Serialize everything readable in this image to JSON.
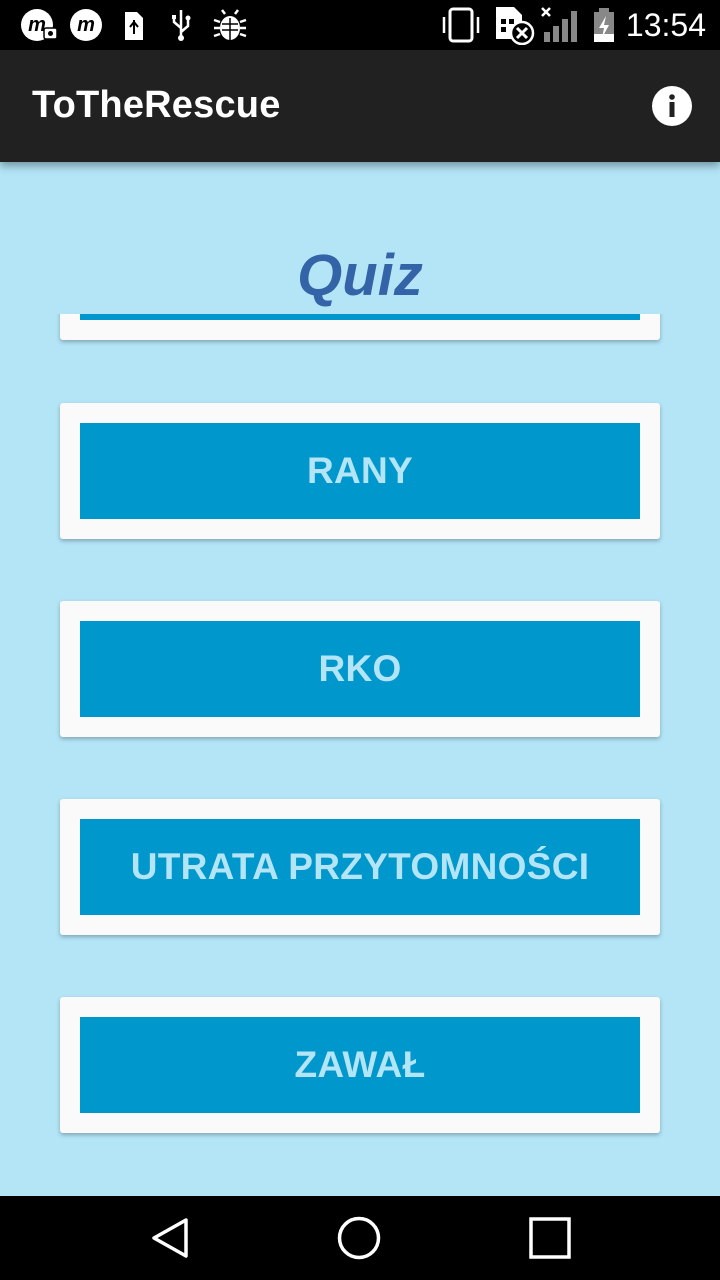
{
  "status_bar": {
    "time": "13:54",
    "icons": [
      "m-camera-icon",
      "m-icon",
      "sd-card-icon",
      "usb-icon",
      "bug-icon",
      "vibrate-icon",
      "sim-error-icon",
      "signal-icon",
      "battery-icon"
    ]
  },
  "app_bar": {
    "title": "ToTheRescue",
    "info_icon": "info-icon"
  },
  "main": {
    "title": "Quiz",
    "categories": [
      {
        "label": ""
      },
      {
        "label": "RANY"
      },
      {
        "label": "RKO"
      },
      {
        "label": "UTRATA PRZYTOMNOŚCI"
      },
      {
        "label": "ZAWAŁ"
      }
    ]
  },
  "nav_bar": {
    "icons": [
      "back-icon",
      "home-icon",
      "recents-icon"
    ]
  },
  "colors": {
    "background": "#b3e5f7",
    "app_bar": "#212121",
    "button": "#0097cc",
    "button_text": "#b3e5f7",
    "title": "#3463a8"
  }
}
